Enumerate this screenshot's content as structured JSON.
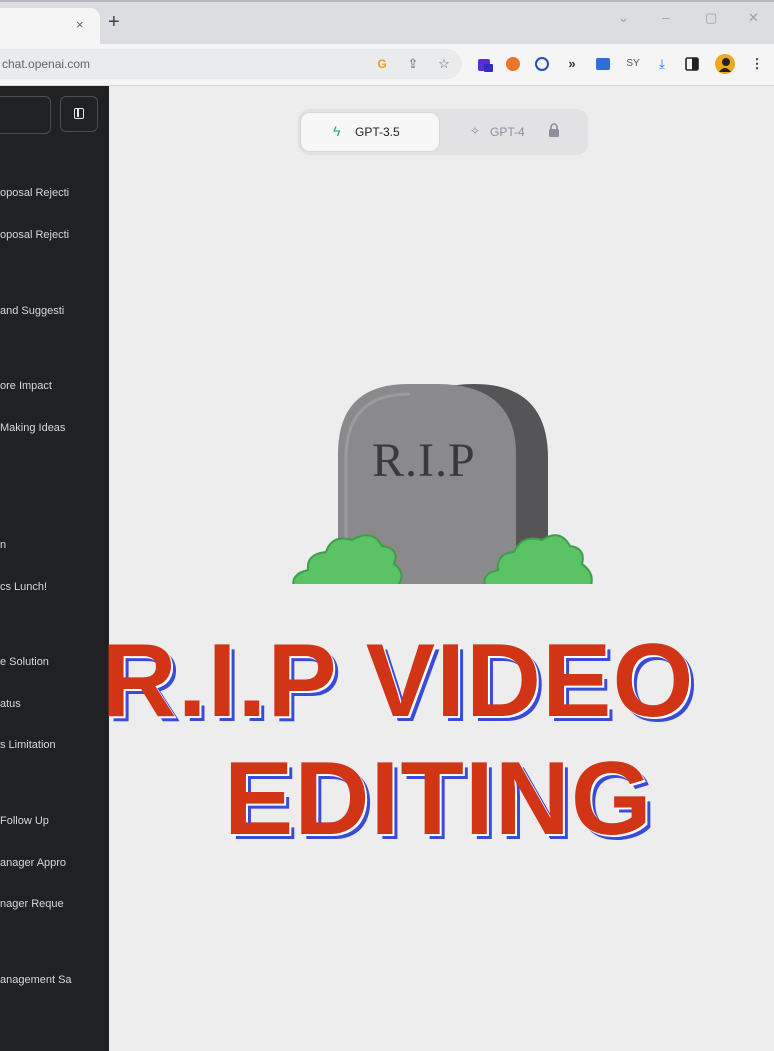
{
  "browser": {
    "tab_close": "×",
    "new_tab": "+",
    "url": "chat.openai.com",
    "window_controls": [
      "⌄",
      "–",
      "▢",
      "✕"
    ],
    "icons": [
      "google-icon",
      "share-icon",
      "bookmark-star-icon",
      "extension-1-icon",
      "extension-2-icon",
      "extension-3-icon",
      "extension-4-icon",
      "extension-5-icon",
      "extension-6-icon",
      "download-icon",
      "side-panel-icon",
      "profile-avatar-icon",
      "kebab-menu-icon"
    ]
  },
  "sidebar": {
    "items": [
      "oposal Rejecti",
      "oposal Rejecti",
      "and Suggesti",
      "ore Impact",
      "Making Ideas",
      "n",
      "cs Lunch!",
      "e Solution",
      "atus",
      "s Limitation",
      "Follow Up",
      "anager Appro",
      "nager Reque",
      "anagement Sa"
    ]
  },
  "model_switcher": {
    "gpt35_label": "GPT-3.5",
    "gpt4_label": "GPT-4"
  },
  "overlay": {
    "tombstone_text": "R.I.P",
    "headline_line1": "R.I.P VIDEO",
    "headline_line2": "EDITING"
  },
  "colors": {
    "headline_red": "#d23416",
    "headline_shadow_blue": "#3a4ad9",
    "sidebar_bg": "#202123",
    "bush_green": "#5cc266"
  }
}
